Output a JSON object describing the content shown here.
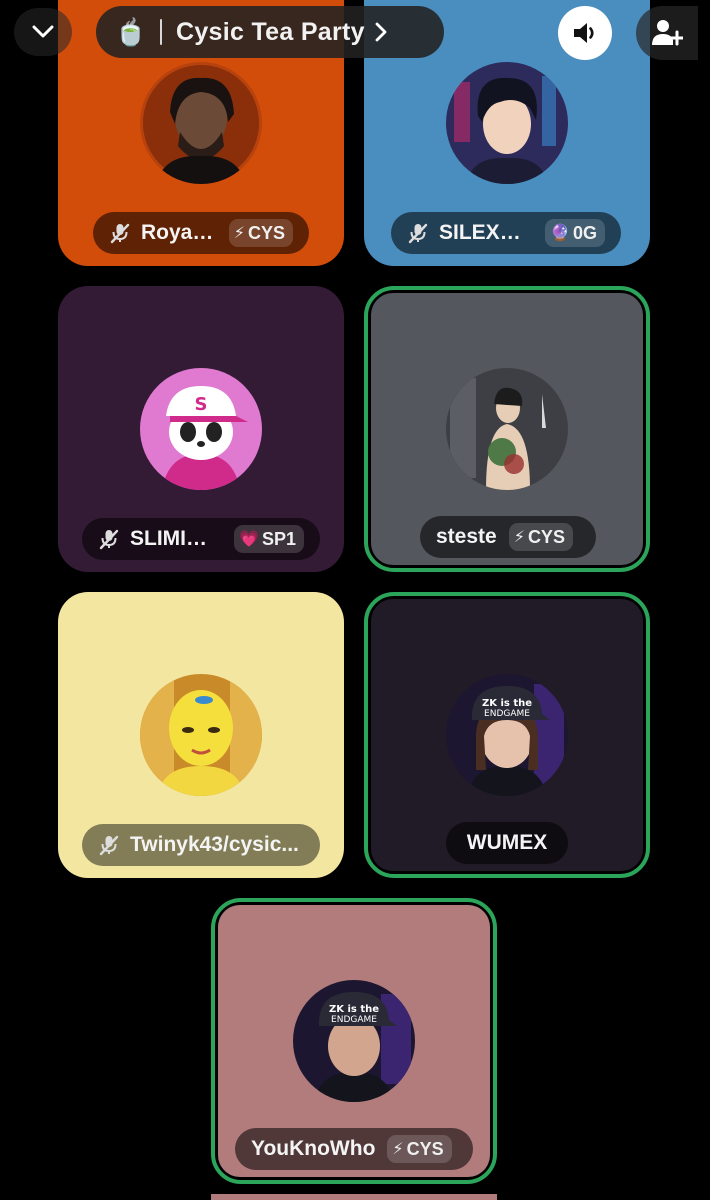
{
  "header": {
    "title_emoji": "🍵",
    "title": "Cysic Tea Party"
  },
  "participants": [
    {
      "name": "Royalty",
      "tag": "CYS",
      "tag_icon": "⚡",
      "muted": true,
      "speaking": false,
      "tile_color": "#d24d0a"
    },
    {
      "name": "SILEXO👑",
      "tag": "0G",
      "tag_icon": "🔮",
      "muted": true,
      "speaking": false,
      "tile_color": "#4a8ebf"
    },
    {
      "name": "SLIMICE...",
      "tag": "SP1",
      "tag_icon": "💗",
      "muted": true,
      "speaking": false,
      "tile_color": "#331b35"
    },
    {
      "name": "steste",
      "tag": "CYS",
      "tag_icon": "⚡",
      "muted": false,
      "speaking": true,
      "tile_color": "#54575d"
    },
    {
      "name": "Twinyk43/cysic...",
      "tag": "",
      "tag_icon": "",
      "muted": true,
      "speaking": false,
      "tile_color": "#f3e6a0"
    },
    {
      "name": "WUMEX",
      "tag": "",
      "tag_icon": "",
      "muted": false,
      "speaking": true,
      "tile_color": "#211a27"
    },
    {
      "name": "YouKnoWho",
      "tag": "CYS",
      "tag_icon": "⚡",
      "muted": false,
      "speaking": true,
      "tile_color": "#b27c7d"
    }
  ]
}
